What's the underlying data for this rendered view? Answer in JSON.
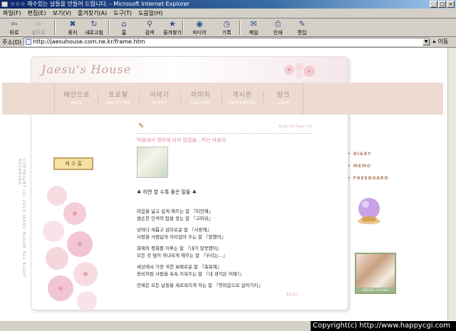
{
  "window": {
    "title": "☆☆☆ 재수있는 날들을 만들어 드립니다. - Microsoft Internet Explorer",
    "buttons": {
      "minimize": "_",
      "maximize": "□",
      "close": "×"
    }
  },
  "menubar": [
    "파일(F)",
    "편집(E)",
    "보기(V)",
    "즐겨찾기(A)",
    "도구(T)",
    "도움말(H)"
  ],
  "toolbar": [
    {
      "label": "뒤로",
      "icon": "back-arrow-icon",
      "glyph": "⇦",
      "enabled": true
    },
    {
      "label": "앞으로",
      "icon": "forward-arrow-icon",
      "glyph": "⇨",
      "enabled": false
    },
    {
      "label": "중지",
      "icon": "stop-icon",
      "glyph": "✖",
      "enabled": true
    },
    {
      "label": "새로고침",
      "icon": "refresh-icon",
      "glyph": "↻",
      "enabled": true
    },
    {
      "label": "홈",
      "icon": "home-icon",
      "glyph": "⌂",
      "enabled": true
    },
    {
      "label": "검색",
      "icon": "search-icon",
      "glyph": "⚲",
      "enabled": true
    },
    {
      "label": "즐겨찾기",
      "icon": "favorites-icon",
      "glyph": "★",
      "enabled": true
    },
    {
      "label": "미디어",
      "icon": "media-icon",
      "glyph": "◉",
      "enabled": true
    },
    {
      "label": "기록",
      "icon": "history-icon",
      "glyph": "◷",
      "enabled": true
    },
    {
      "label": "메일",
      "icon": "mail-icon",
      "glyph": "✉",
      "enabled": true
    },
    {
      "label": "인쇄",
      "icon": "print-icon",
      "glyph": "⎙",
      "enabled": true
    },
    {
      "label": "편집",
      "icon": "edit-icon",
      "glyph": "✎",
      "enabled": true
    }
  ],
  "address": {
    "label": "주소(D)",
    "url": "http://jaesuhouse.com.ne.kr/frame.htm",
    "go_label": "이동"
  },
  "site": {
    "logo": "Jaesu's House",
    "nav": [
      {
        "label": "메인으로",
        "sub": "MAIN"
      },
      {
        "label": "프로필",
        "sub": "ABOUT ME"
      },
      {
        "label": "이야기",
        "sub": "STORY"
      },
      {
        "label": "이미지",
        "sub": "GALLERY"
      },
      {
        "label": "게시판",
        "sub": "FREEBOARD"
      },
      {
        "label": "링크",
        "sub": "LINK"
      }
    ],
    "vertical_copyright": "COPYRIGHT (C) 2004 JAESU HOUSE ALL RIGHT RESERVED",
    "left_badge": "재 수 홈",
    "right_menu": [
      "DIARY",
      "MEMO",
      "FREEBOARD"
    ],
    "banner_text": "SPRING SPRING SPRING SP",
    "post": {
      "meta": "Total 14 Page 1/5",
      "title": "마음에서 정이게 되지 않았음...하는 마음이",
      "heading": "♣ 하면 할 수록 좋은 말들 ♣",
      "lines": [
        "마음을 넓고 깊게 해주는 말  『미안해』",
        "겸손한 인격의 탑을 쌓는 말  『고마워』",
        "",
        "낯마다 새롭고 감미로운 말  『사랑해』",
        "사람을 사람답게 자리잡아 주는 말  『잘했어』",
        "",
        "화해와 평화를 이루는 말  『내가 잘못했어』",
        "모든 것 덮어 하나되게 해주는 말  『우리는...』",
        "",
        "세상에서 가장 귀한 보배로운 말  『축복해』",
        "용비처럼 사람을 속속 키워주는 말  『네 생각은 어때?』",
        "",
        "언제든 모든 날들을 새로워지게 하는 말  『첫마음으로 살아가지』"
      ],
      "sign": "지니니"
    }
  },
  "watermark": "Copyright(c) http://www.happycgi.com"
}
